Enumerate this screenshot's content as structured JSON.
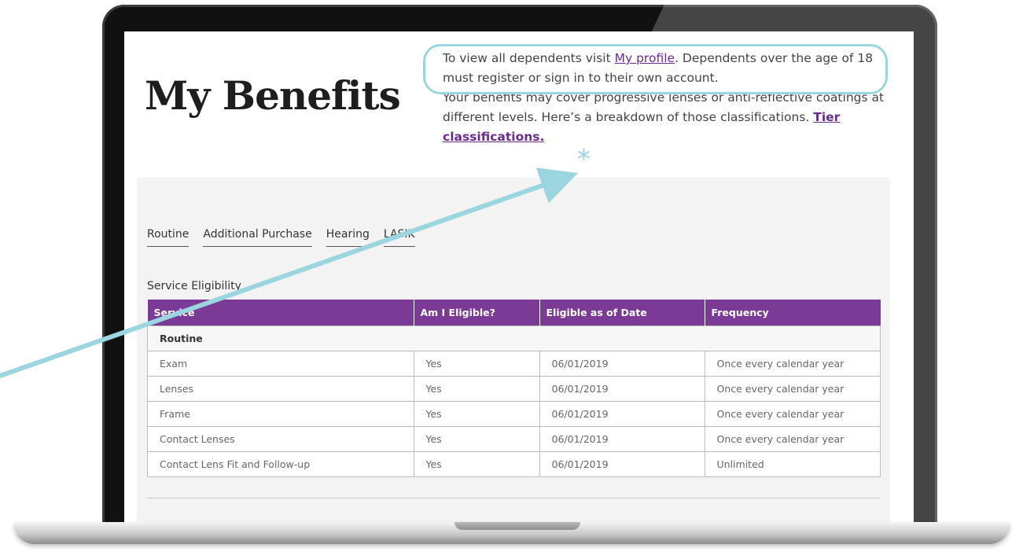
{
  "page": {
    "title": "My Benefits",
    "intro": {
      "line1_prefix": "To view all dependents visit ",
      "profile_link": "My profile",
      "line1_suffix": ". Dependents over the age of 18 must register or sign in to their own account.",
      "line2_prefix": "Your benefits may cover progressive lenses or anti-reflective coatings at different levels. Here’s a breakdown of those classifications. ",
      "tier_link": "Tier classifications."
    },
    "annotation_mark": "*"
  },
  "tabs": [
    {
      "label": "Routine"
    },
    {
      "label": "Additional Purchase"
    },
    {
      "label": "Hearing"
    },
    {
      "label": "LASIK"
    }
  ],
  "eligibility": {
    "section_title": "Service Eligibility",
    "columns": [
      "Service",
      "Am I Eligible?",
      "Eligible as of Date",
      "Frequency"
    ],
    "group": "Routine",
    "rows": [
      [
        "Exam",
        "Yes",
        "06/01/2019",
        "Once every calendar year"
      ],
      [
        "Lenses",
        "Yes",
        "06/01/2019",
        "Once every calendar year"
      ],
      [
        "Frame",
        "Yes",
        "06/01/2019",
        "Once every calendar year"
      ],
      [
        "Contact Lenses",
        "Yes",
        "06/01/2019",
        "Once every calendar year"
      ],
      [
        "Contact Lens Fit and Follow-up",
        "Yes",
        "06/01/2019",
        "Unlimited"
      ]
    ]
  },
  "colors": {
    "accent_purple": "#7b3a96",
    "link_purple": "#6a2c8f",
    "annotation_teal": "#9bd6e0"
  }
}
